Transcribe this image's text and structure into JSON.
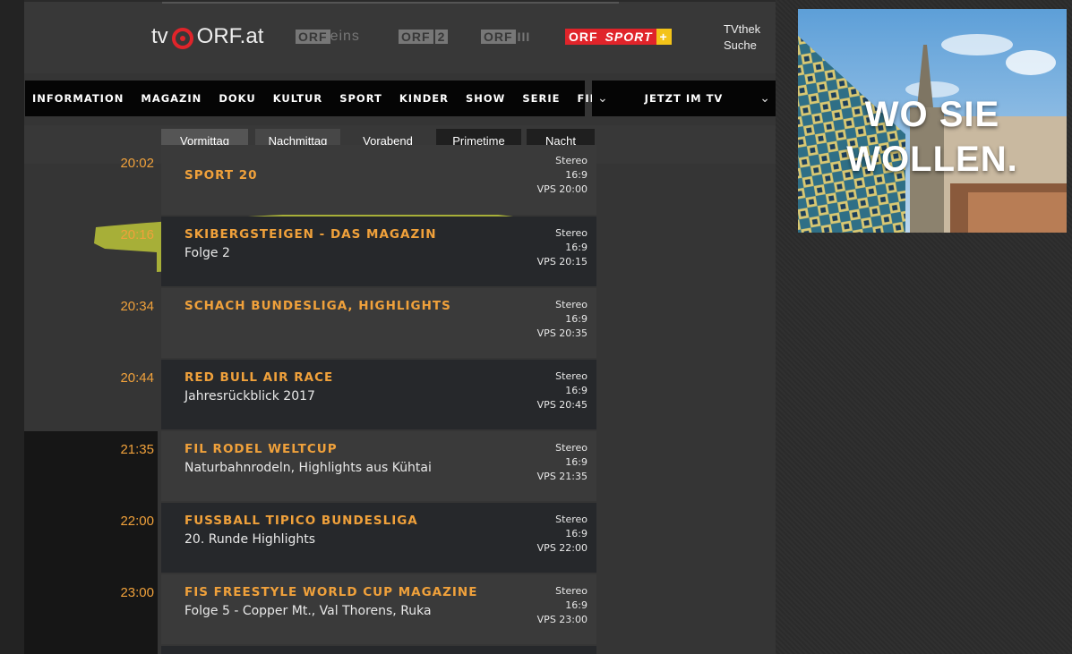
{
  "header": {
    "logos": {
      "tv_prefix": "tv",
      "orf_at": "ORF.at",
      "orf_eins_a": "ORF",
      "orf_eins_b": "eins",
      "orf2_a": "ORF",
      "orf2_b": "2",
      "orf3_a": "ORF",
      "orf3_b": "III",
      "sport_orf": "ORF",
      "sport_word": "SPORT",
      "sport_plus": "+"
    },
    "tvthek": "TVthek",
    "suche": "Suche"
  },
  "nav": {
    "items": [
      "INFORMATION",
      "MAGAZIN",
      "DOKU",
      "KULTUR",
      "SPORT",
      "KINDER",
      "SHOW",
      "SERIE",
      "FILM"
    ],
    "now_tv": "JETZT IM TV"
  },
  "timeslots": [
    "Vormittag",
    "Nachmittag",
    "Vorabend",
    "Primetime",
    "Nacht"
  ],
  "programs": [
    {
      "time": "20:02",
      "title": "SPORT 20",
      "subtitle": "",
      "audio": "Stereo",
      "format": "16:9",
      "vps": "VPS 20:00"
    },
    {
      "time": "20:16",
      "title": "SKIBERGSTEIGEN - DAS MAGAZIN",
      "subtitle": "Folge 2",
      "audio": "Stereo",
      "format": "16:9",
      "vps": "VPS 20:15"
    },
    {
      "time": "20:34",
      "title": "SCHACH BUNDESLIGA, HIGHLIGHTS",
      "subtitle": "",
      "audio": "Stereo",
      "format": "16:9",
      "vps": "VPS 20:35"
    },
    {
      "time": "20:44",
      "title": "RED BULL AIR RACE",
      "subtitle": "Jahresrückblick 2017",
      "audio": "Stereo",
      "format": "16:9",
      "vps": "VPS 20:45"
    },
    {
      "time": "21:35",
      "title": "FIL RODEL WELTCUP",
      "subtitle": "Naturbahnrodeln, Highlights aus Kühtai",
      "audio": "Stereo",
      "format": "16:9",
      "vps": "VPS 21:35"
    },
    {
      "time": "22:00",
      "title": "FUSSBALL TIPICO BUNDESLIGA",
      "subtitle": "20. Runde Highlights",
      "audio": "Stereo",
      "format": "16:9",
      "vps": "VPS 22:00"
    },
    {
      "time": "23:00",
      "title": "FIS FREESTYLE WORLD CUP MAGAZINE",
      "subtitle": "Folge 5 - Copper Mt., Val Thorens, Ruka",
      "audio": "Stereo",
      "format": "16:9",
      "vps": "VPS 23:00"
    }
  ],
  "ad": {
    "line1": "WO SIE",
    "line2": "WOLLEN."
  },
  "colors": {
    "accent": "#f0a13b",
    "highlight": "#c8d23a",
    "orf_red": "#e0242a"
  }
}
